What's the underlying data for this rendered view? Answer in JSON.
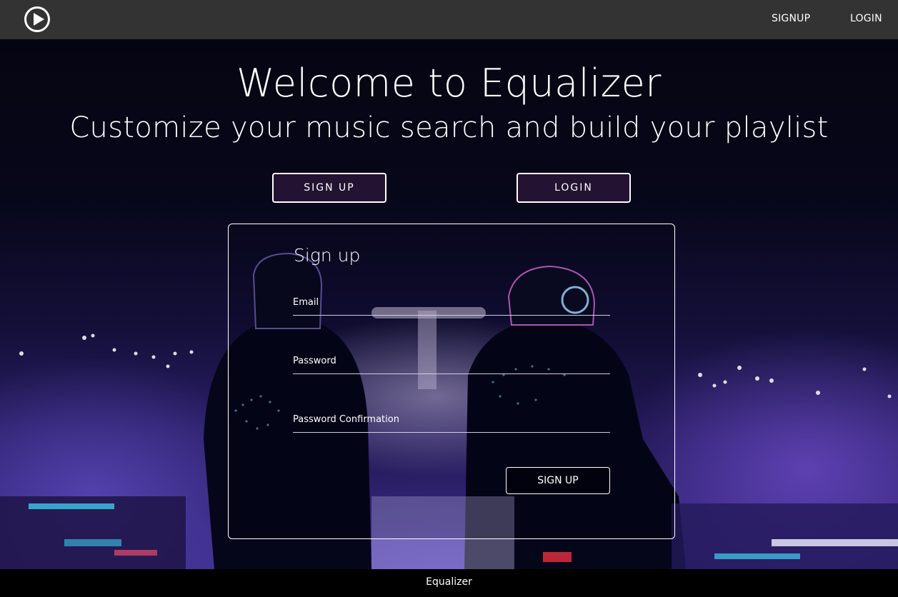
{
  "navbar": {
    "logo_icon": "play-circle-icon",
    "signup_label": "SIGNUP",
    "login_label": "LOGIN",
    "background": "#333333"
  },
  "hero": {
    "title": "Welcome to Equalizer",
    "subtitle": "Customize your music search and build your playlist",
    "signup_button": "SIGN UP",
    "login_button": "LOGIN"
  },
  "signup_form": {
    "title": "Sign up",
    "email_label": "Email",
    "password_label": "Password",
    "password_confirmation_label": "Password Confirmation",
    "email_value": "",
    "password_value": "",
    "password_confirmation_value": "",
    "submit_label": "SIGN UP"
  },
  "footer": {
    "text": "Equalizer"
  }
}
